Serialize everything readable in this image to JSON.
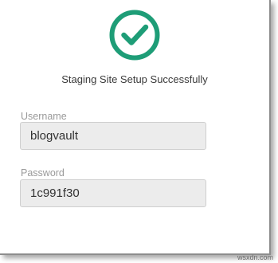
{
  "status": {
    "icon": "check-circle-icon",
    "color": "#1e9d77",
    "message": "Staging Site Setup Successfully"
  },
  "form": {
    "username": {
      "label": "Username",
      "value": "blogvault"
    },
    "password": {
      "label": "Password",
      "value": "1c991f30"
    }
  },
  "watermark": "wsxdn.com"
}
